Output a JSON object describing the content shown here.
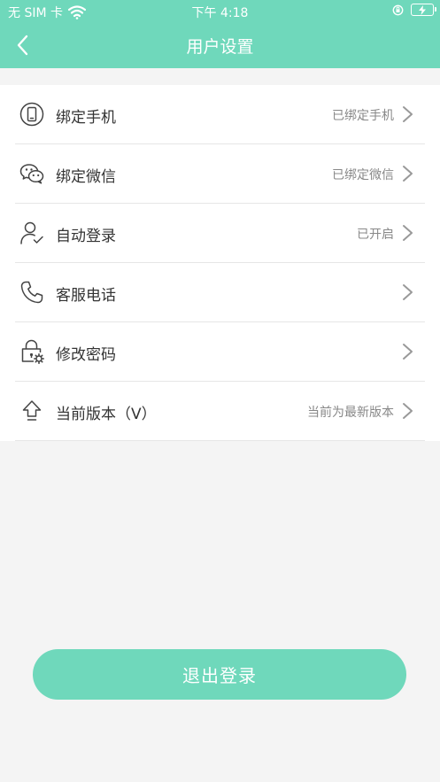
{
  "status_bar": {
    "carrier": "无 SIM 卡",
    "time": "下午 4:18"
  },
  "nav": {
    "title": "用户设置"
  },
  "settings": [
    {
      "label": "绑定手机",
      "value": "已绑定手机",
      "icon": "phone-icon"
    },
    {
      "label": "绑定微信",
      "value": "已绑定微信",
      "icon": "wechat-icon"
    },
    {
      "label": "自动登录",
      "value": "已开启",
      "icon": "user-check-icon"
    },
    {
      "label": "客服电话",
      "value": "",
      "icon": "telephone-icon"
    },
    {
      "label": "修改密码",
      "value": "",
      "icon": "lock-gear-icon"
    },
    {
      "label": "当前版本（V）",
      "value": "当前为最新版本",
      "icon": "upload-arrow-icon"
    }
  ],
  "logout": {
    "label": "退出登录"
  },
  "colors": {
    "accent": "#6fd8bb",
    "background": "#f4f4f4"
  }
}
